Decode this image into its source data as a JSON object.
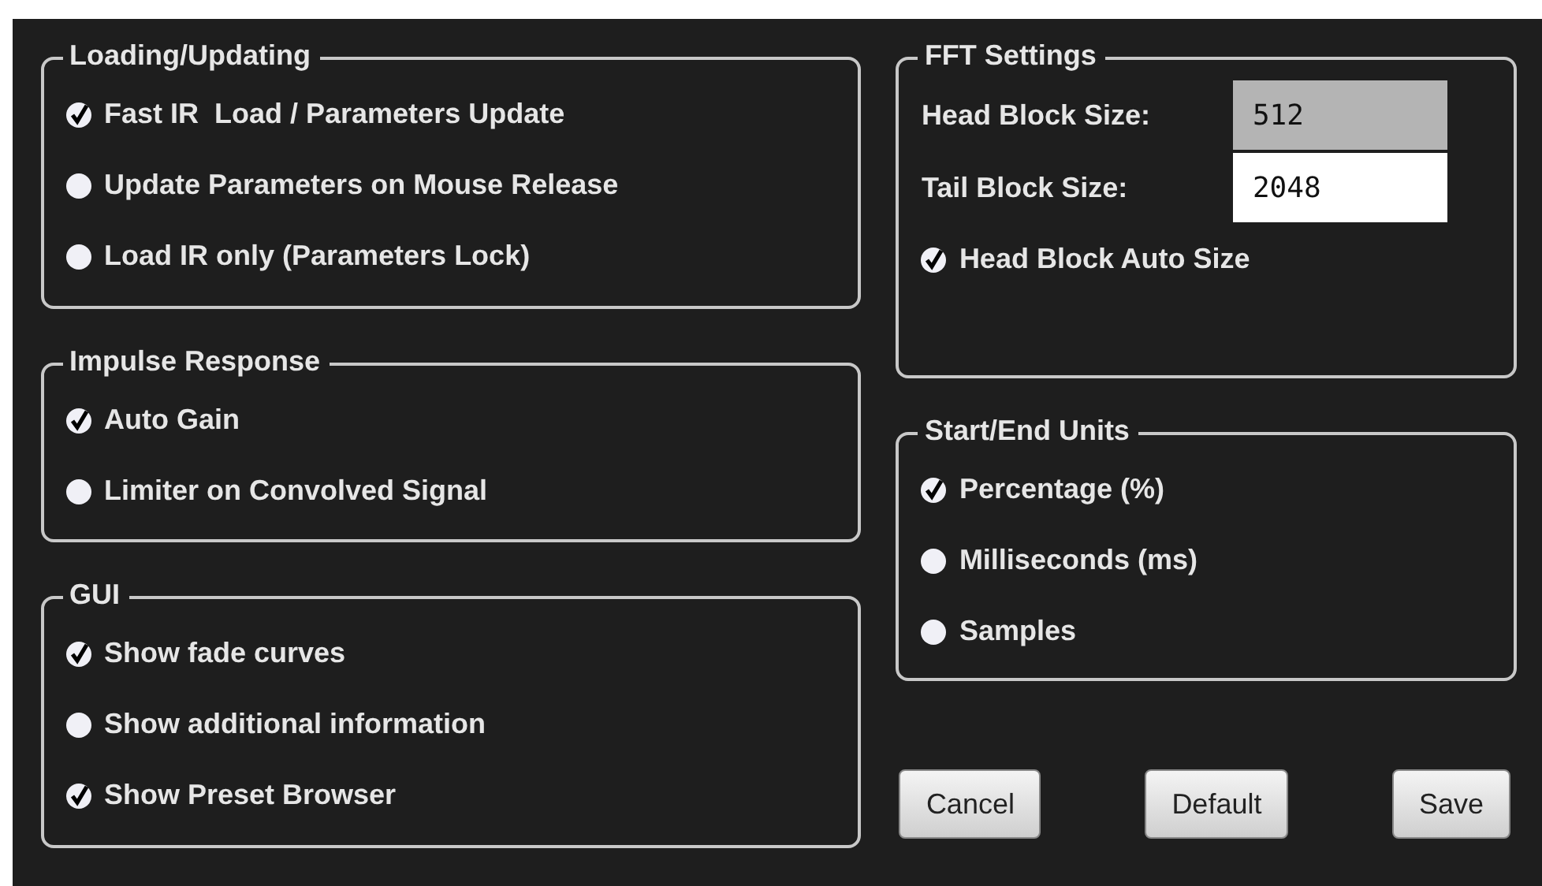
{
  "groups_left": [
    {
      "title": "Loading/Updating",
      "options": [
        {
          "label": "Fast IR  Load / Parameters Update",
          "checked": true
        },
        {
          "label": "Update Parameters on Mouse Release",
          "checked": false
        },
        {
          "label": "Load IR only (Parameters Lock)",
          "checked": false
        }
      ]
    },
    {
      "title": "Impulse Response",
      "options": [
        {
          "label": "Auto Gain",
          "checked": true
        },
        {
          "label": "Limiter on Convolved Signal",
          "checked": false
        }
      ]
    },
    {
      "title": "GUI",
      "options": [
        {
          "label": "Show fade curves",
          "checked": true
        },
        {
          "label": "Show additional information",
          "checked": false
        },
        {
          "label": "Show Preset Browser",
          "checked": true
        }
      ]
    }
  ],
  "fft_settings": {
    "title": "FFT Settings",
    "fields": [
      {
        "label": "Head Block Size:",
        "value": "512",
        "disabled": true
      },
      {
        "label": "Tail Block Size:",
        "value": "2048",
        "disabled": false
      }
    ],
    "options": [
      {
        "label": "Head Block Auto Size",
        "checked": true
      }
    ]
  },
  "start_end_units": {
    "title": "Start/End Units",
    "options": [
      {
        "label": "Percentage (%)",
        "checked": true
      },
      {
        "label": "Milliseconds (ms)",
        "checked": false
      },
      {
        "label": "Samples",
        "checked": false
      }
    ]
  },
  "buttons": [
    "Cancel",
    "Default",
    "Save"
  ]
}
